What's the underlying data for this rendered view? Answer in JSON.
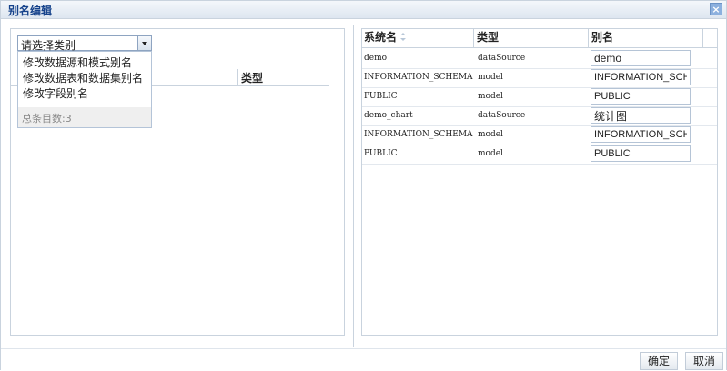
{
  "dialog": {
    "title": "别名编辑",
    "close_label": "×"
  },
  "left": {
    "select": {
      "value": "请选择类别"
    },
    "dropdown": {
      "items": [
        "修改数据源和模式别名",
        "修改数据表和数据集别名",
        "修改字段别名"
      ],
      "total": "总条目数:3"
    },
    "grid": {
      "header_type": "类型"
    }
  },
  "right": {
    "headers": {
      "system_name": "系统名",
      "type": "类型",
      "alias": "别名"
    },
    "rows": [
      {
        "system_name": "demo",
        "type": "dataSource",
        "alias": "demo"
      },
      {
        "system_name": "INFORMATION_SCHEMA",
        "type": "model",
        "alias": "INFORMATION_SCHEMA"
      },
      {
        "system_name": "PUBLIC",
        "type": "model",
        "alias": "PUBLIC"
      },
      {
        "system_name": "demo_chart",
        "type": "dataSource",
        "alias": "统计图"
      },
      {
        "system_name": "INFORMATION_SCHEMA",
        "type": "model",
        "alias": "INFORMATION_SCHEMA"
      },
      {
        "system_name": "PUBLIC",
        "type": "model",
        "alias": "PUBLIC"
      }
    ]
  },
  "buttons": {
    "ok": "确定",
    "cancel": "取消"
  }
}
